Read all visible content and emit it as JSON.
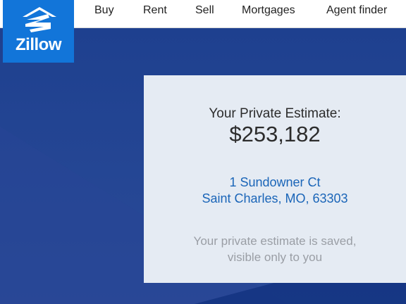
{
  "brand": {
    "name": "Zillow"
  },
  "nav": {
    "items": [
      "Buy",
      "Rent",
      "Sell",
      "Mortgages",
      "Agent finder"
    ]
  },
  "estimate": {
    "label": "Your Private Estimate:",
    "value": "$253,182"
  },
  "address": {
    "line1": "1 Sundowner Ct",
    "line2": "Saint Charles, MO, 63303"
  },
  "note": {
    "line1": "Your private estimate is saved,",
    "line2": "visible only to you"
  },
  "colors": {
    "brand_blue": "#1275d9",
    "background": "#1f4594",
    "card": "#e5ebf3",
    "link": "#1a65b8",
    "muted": "#9a9ea5"
  }
}
